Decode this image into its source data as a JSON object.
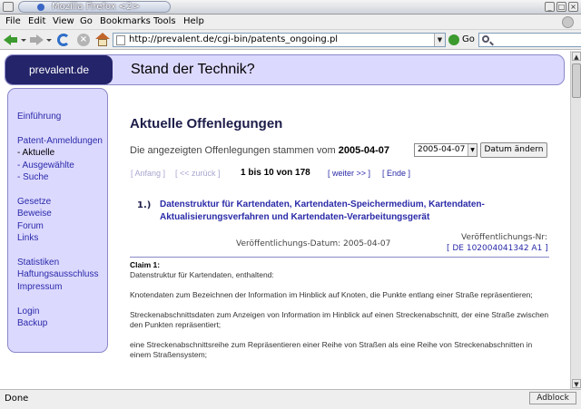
{
  "window": {
    "title": "Mozilla Firefox <2>"
  },
  "menu": [
    "File",
    "Edit",
    "View",
    "Go",
    "Bookmarks",
    "Tools",
    "Help"
  ],
  "nav": {
    "url": "http://prevalent.de/cgi-bin/patents_ongoing.pl",
    "go_label": "Go"
  },
  "header": {
    "logo": "prevalent.de",
    "title": "Stand der Technik?"
  },
  "sidebar": {
    "items": [
      {
        "label": "Einführung"
      },
      {
        "label": "Patent-Anmeldungen"
      },
      {
        "label": "- Aktuelle"
      },
      {
        "label": "- Ausgewählte"
      },
      {
        "label": "- Suche"
      },
      {
        "label": "Gesetze"
      },
      {
        "label": "Beweise"
      },
      {
        "label": "Forum"
      },
      {
        "label": "Links"
      },
      {
        "label": "Statistiken"
      },
      {
        "label": "Haftungsausschluss"
      },
      {
        "label": "Impressum"
      },
      {
        "label": "Login"
      },
      {
        "label": "Backup"
      }
    ]
  },
  "main": {
    "heading": "Aktuelle Offenlegungen",
    "intro_text": "Die angezeigten Offenlegungen stammen vom",
    "intro_date": "2005-04-07",
    "date_select": "2005-04-07",
    "date_button": "Datum ändern",
    "pager": {
      "first": "[ Anfang ]",
      "prev": "[ << zurück ]",
      "count": "1 bis 10 von 178",
      "next": "[ weiter >> ]",
      "last": "[ Ende ]"
    },
    "item": {
      "number": "1.)",
      "title": "Datenstruktur für Kartendaten, Kartendaten-Speichermedium, Kartendaten-Aktualisierungsverfahren und Kartendaten-Verarbeitungsgerät",
      "pub_date": "Veröffentlichungs-Datum: 2005-04-07",
      "pub_nr_label": "Veröffentlichungs-Nr:",
      "pub_nr": "[ DE 102004041342 A1 ]",
      "claim_heading": "Claim 1:",
      "claim_lines": [
        "Datenstruktur für Kartendaten, enthaltend:",
        "Knotendaten zum Bezeichnen der Information im Hinblick auf Knoten, die Punkte entlang einer Straße repräsentieren;",
        "Streckenabschnittsdaten zum Anzeigen von Information im Hinblick auf einen Streckenabschnitt, der eine Straße zwischen den Punkten repräsentiert;",
        "eine Streckenabschnittsreihe zum Repräsentieren einer Reihe von Straßen als eine Reihe von Streckenabschnitten in einem Straßensystem;"
      ]
    }
  },
  "status": {
    "text": "Done",
    "adblock": "Adblock"
  }
}
